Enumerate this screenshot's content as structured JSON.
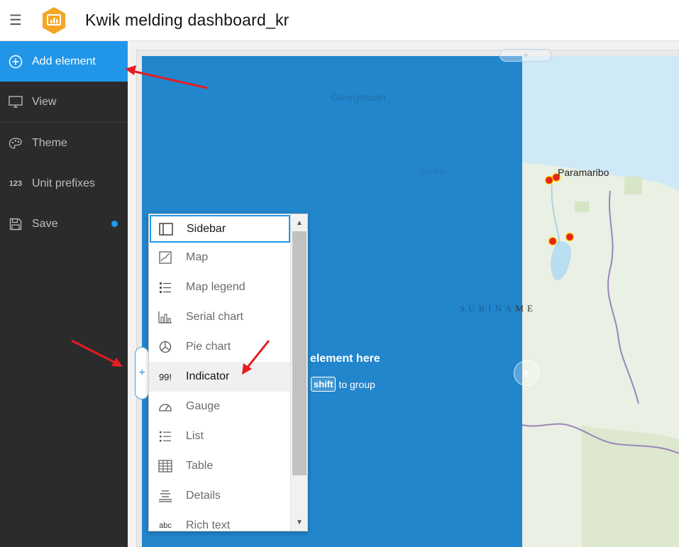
{
  "header": {
    "title": "Kwik melding dashboard_kr",
    "menu_icon": "hamburger-icon",
    "logo_icon": "dashboard-logo-icon",
    "logo_color": "#f5a623"
  },
  "sidebar": {
    "items": [
      {
        "label": "Add element",
        "icon": "plus-circle-icon",
        "active": true
      },
      {
        "label": "View",
        "icon": "monitor-icon"
      },
      {
        "label": "Theme",
        "icon": "palette-icon"
      },
      {
        "label": "Unit prefixes",
        "icon": "123-icon"
      },
      {
        "label": "Save",
        "icon": "floppy-icon",
        "unsaved_indicator": true
      }
    ],
    "accent": "#2196e8",
    "background": "#2b2b2b"
  },
  "canvas": {
    "drop_text": "element here",
    "drop_sub_key": "shift",
    "drop_sub_text": "to group",
    "overlay_color": "#2286cc"
  },
  "map": {
    "labels": {
      "georgetown": "Georgetown",
      "bigi_pan": "Bigi Pan",
      "paramaribo": "Paramaribo",
      "suriname_dim": "SURINA",
      "suriname_rest": "ME"
    },
    "marker_color": "#e8231e"
  },
  "dropdown": {
    "items": [
      {
        "label": "Sidebar",
        "icon": "sidebar-icon",
        "state": "selected"
      },
      {
        "label": "Map",
        "icon": "map-icon"
      },
      {
        "label": "Map legend",
        "icon": "legend-icon"
      },
      {
        "label": "Serial chart",
        "icon": "serial-chart-icon"
      },
      {
        "label": "Pie chart",
        "icon": "pie-chart-icon"
      },
      {
        "label": "Indicator",
        "icon": "indicator-icon",
        "glyph": "99!",
        "state": "hover"
      },
      {
        "label": "Gauge",
        "icon": "gauge-icon"
      },
      {
        "label": "List",
        "icon": "list-icon"
      },
      {
        "label": "Table",
        "icon": "table-icon"
      },
      {
        "label": "Details",
        "icon": "details-icon"
      },
      {
        "label": "Rich text",
        "icon": "rich-text-icon",
        "glyph": "abc"
      }
    ]
  },
  "annotations": {
    "arrow_color": "#e51c23"
  }
}
